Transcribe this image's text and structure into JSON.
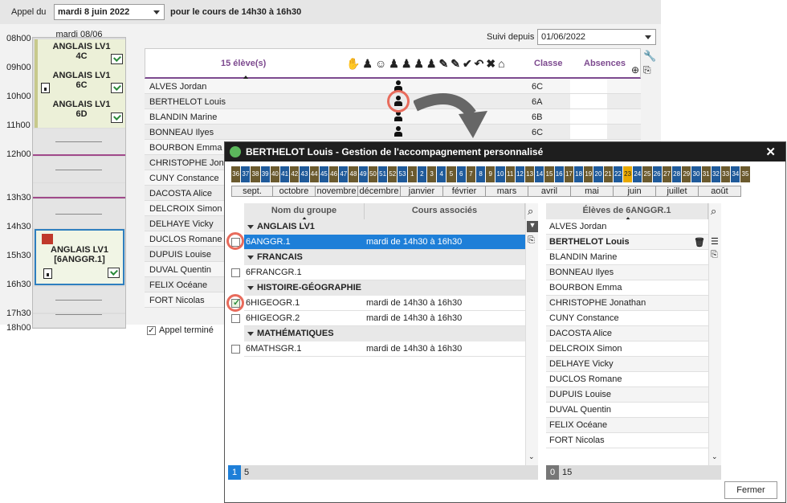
{
  "topbar": {
    "label_call": "Appel du",
    "date_value": "mardi 8 juin 2022",
    "course_label": "pour le cours de 14h30 à 16h30"
  },
  "hours": [
    "08h00",
    "09h00",
    "10h00",
    "11h00",
    "12h00",
    "13h30",
    "14h30",
    "15h30",
    "16h30",
    "17h30",
    "18h00"
  ],
  "calendar": {
    "day_header": "mardi 08/06",
    "courses": [
      {
        "line1": "ANGLAIS LV1",
        "line2": "4C"
      },
      {
        "line1": "ANGLAIS LV1",
        "line2": "6C"
      },
      {
        "line1": "ANGLAIS LV1",
        "line2": "6D"
      },
      {
        "line1": "ANGLAIS LV1",
        "line2": "[6ANGGR.1]"
      }
    ]
  },
  "follow": {
    "label": "Suivi depuis",
    "value": "01/06/2022"
  },
  "students_panel": {
    "count_header": "15 élève(s)",
    "class_header": "Classe",
    "absences_header": "Absences",
    "rows": [
      {
        "name": "ALVES Jordan",
        "class": "6C"
      },
      {
        "name": "BERTHELOT Louis",
        "class": "6A"
      },
      {
        "name": "BLANDIN Marine",
        "class": "6B"
      },
      {
        "name": "BONNEAU Ilyes",
        "class": "6C"
      },
      {
        "name": "BOURBON Emma",
        "class": ""
      },
      {
        "name": "CHRISTOPHE Jonat",
        "class": ""
      },
      {
        "name": "CUNY Constance",
        "class": ""
      },
      {
        "name": "DACOSTA Alice",
        "class": ""
      },
      {
        "name": "DELCROIX Simon",
        "class": ""
      },
      {
        "name": "DELHAYE Vicky",
        "class": ""
      },
      {
        "name": "DUCLOS Romane",
        "class": ""
      },
      {
        "name": "DUPUIS Louise",
        "class": ""
      },
      {
        "name": "DUVAL Quentin",
        "class": ""
      },
      {
        "name": "FELIX Océane",
        "class": ""
      },
      {
        "name": "FORT Nicolas",
        "class": ""
      }
    ],
    "done_label": "Appel terminé"
  },
  "dialog": {
    "title": "BERTHELOT Louis - Gestion de l'accompagnement personnalisé",
    "weeks": [
      "36",
      "37",
      "38",
      "39",
      "40",
      "41",
      "42",
      "43",
      "44",
      "45",
      "46",
      "47",
      "48",
      "49",
      "50",
      "51",
      "52",
      "53",
      "1",
      "2",
      "3",
      "4",
      "5",
      "6",
      "7",
      "8",
      "9",
      "10",
      "11",
      "12",
      "13",
      "14",
      "15",
      "16",
      "17",
      "18",
      "19",
      "20",
      "21",
      "22",
      "23",
      "24",
      "25",
      "26",
      "27",
      "28",
      "29",
      "30",
      "31",
      "32",
      "33",
      "34",
      "35"
    ],
    "months": [
      "sept.",
      "octobre",
      "novembre",
      "décembre",
      "janvier",
      "février",
      "mars",
      "avril",
      "mai",
      "juin",
      "juillet",
      "août"
    ],
    "groups_header": {
      "name": "Nom du groupe",
      "courses": "Cours associés"
    },
    "groups": [
      {
        "type": "cat",
        "label": "ANGLAIS LV1"
      },
      {
        "type": "row",
        "name": "6ANGGR.1",
        "course": "mardi de 14h30 à 16h30",
        "checked": false,
        "selected": true
      },
      {
        "type": "cat",
        "label": "FRANCAIS"
      },
      {
        "type": "row",
        "name": "6FRANCGR.1",
        "course": "",
        "checked": false,
        "selected": false
      },
      {
        "type": "cat",
        "label": "HISTOIRE-GÉOGRAPHIE"
      },
      {
        "type": "row",
        "name": "6HIGEOGR.1",
        "course": "mardi de 14h30 à 16h30",
        "checked": true,
        "selected": false
      },
      {
        "type": "row",
        "name": "6HIGEOGR.2",
        "course": "mardi de 14h30 à 16h30",
        "checked": false,
        "selected": false
      },
      {
        "type": "cat",
        "label": "MATHÉMATIQUES"
      },
      {
        "type": "row",
        "name": "6MATHSGR.1",
        "course": "mardi de 14h30 à 16h30",
        "checked": false,
        "selected": false
      }
    ],
    "groups_footer": {
      "selected": "1",
      "total": "5"
    },
    "students_header": "Élèves de 6ANGGR.1",
    "students": [
      "ALVES Jordan",
      "BERTHELOT Louis",
      "BLANDIN Marine",
      "BONNEAU Ilyes",
      "BOURBON Emma",
      "CHRISTOPHE Jonathan",
      "CUNY Constance",
      "DACOSTA Alice",
      "DELCROIX Simon",
      "DELHAYE Vicky",
      "DUCLOS Romane",
      "DUPUIS Louise",
      "DUVAL Quentin",
      "FELIX Océane",
      "FORT Nicolas"
    ],
    "students_footer": {
      "selected": "0",
      "total": "15"
    },
    "close_label": "Fermer"
  },
  "colors": {
    "week_blue": "#1f5a9a",
    "week_brown": "#6b5a2e",
    "week_current": "#e8a800",
    "selection": "#1e7fd8",
    "accent": "#7d4a8f"
  }
}
